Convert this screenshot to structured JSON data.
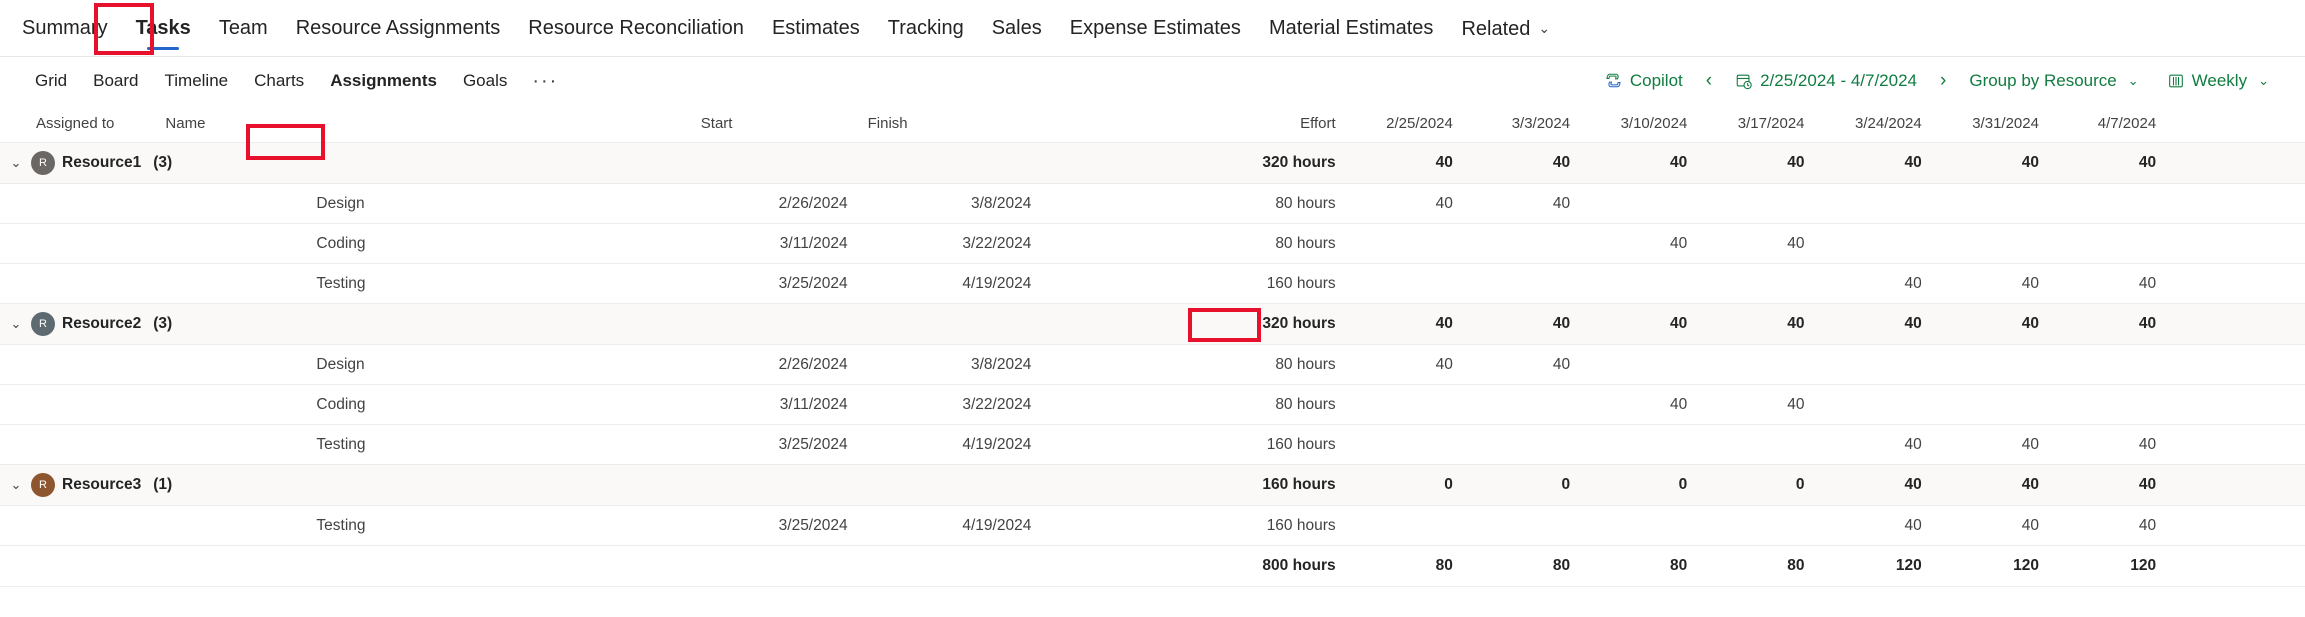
{
  "topnav": {
    "items": [
      {
        "label": "Summary",
        "active": false,
        "caret": false
      },
      {
        "label": "Tasks",
        "active": true,
        "caret": false
      },
      {
        "label": "Team",
        "active": false,
        "caret": false
      },
      {
        "label": "Resource Assignments",
        "active": false,
        "caret": false
      },
      {
        "label": "Resource Reconciliation",
        "active": false,
        "caret": false
      },
      {
        "label": "Estimates",
        "active": false,
        "caret": false
      },
      {
        "label": "Tracking",
        "active": false,
        "caret": false
      },
      {
        "label": "Sales",
        "active": false,
        "caret": false
      },
      {
        "label": "Expense Estimates",
        "active": false,
        "caret": false
      },
      {
        "label": "Material Estimates",
        "active": false,
        "caret": false
      },
      {
        "label": "Related",
        "active": false,
        "caret": true
      }
    ],
    "caret_glyph": "⌄"
  },
  "subnav": {
    "items": [
      {
        "label": "Grid",
        "active": false
      },
      {
        "label": "Board",
        "active": false
      },
      {
        "label": "Timeline",
        "active": false
      },
      {
        "label": "Charts",
        "active": false
      },
      {
        "label": "Assignments",
        "active": true
      },
      {
        "label": "Goals",
        "active": false
      }
    ],
    "overflow_label": "···"
  },
  "toolbar": {
    "copilot_label": "Copilot",
    "prev_glyph": "‹",
    "next_glyph": "›",
    "date_range": "2/25/2024 - 4/7/2024",
    "group_by_label": "Group by Resource",
    "scale_label": "Weekly",
    "caret_glyph": "⌄",
    "accent_color": "#107c41"
  },
  "grid": {
    "columns": {
      "assigned_to": "Assigned to",
      "name": "Name",
      "start": "Start",
      "finish": "Finish",
      "effort": "Effort"
    },
    "week_columns": [
      "2/25/2024",
      "3/3/2024",
      "3/10/2024",
      "3/17/2024",
      "3/24/2024",
      "3/31/2024",
      "4/7/2024"
    ],
    "groups": [
      {
        "name": "Resource1",
        "count": "(3)",
        "avatar_letter": "R",
        "avatar_color": "#6b6764",
        "effort": "320 hours",
        "weeks": [
          "40",
          "40",
          "40",
          "40",
          "40",
          "40",
          "40"
        ],
        "tasks": [
          {
            "name": "Design",
            "start": "2/26/2024",
            "finish": "3/8/2024",
            "effort": "80 hours",
            "weeks": [
              "40",
              "40",
              "",
              "",
              "",
              "",
              ""
            ]
          },
          {
            "name": "Coding",
            "start": "3/11/2024",
            "finish": "3/22/2024",
            "effort": "80 hours",
            "weeks": [
              "",
              "",
              "40",
              "40",
              "",
              "",
              ""
            ]
          },
          {
            "name": "Testing",
            "start": "3/25/2024",
            "finish": "4/19/2024",
            "effort": "160 hours",
            "weeks": [
              "",
              "",
              "",
              "",
              "40",
              "40",
              "40"
            ]
          }
        ]
      },
      {
        "name": "Resource2",
        "count": "(3)",
        "avatar_letter": "R",
        "avatar_color": "#5d6b70",
        "effort": "320 hours",
        "weeks": [
          "40",
          "40",
          "40",
          "40",
          "40",
          "40",
          "40"
        ],
        "tasks": [
          {
            "name": "Design",
            "start": "2/26/2024",
            "finish": "3/8/2024",
            "effort": "80 hours",
            "weeks": [
              "40",
              "40",
              "",
              "",
              "",
              "",
              ""
            ]
          },
          {
            "name": "Coding",
            "start": "3/11/2024",
            "finish": "3/22/2024",
            "effort": "80 hours",
            "weeks": [
              "",
              "",
              "40",
              "40",
              "",
              "",
              ""
            ]
          },
          {
            "name": "Testing",
            "start": "3/25/2024",
            "finish": "4/19/2024",
            "effort": "160 hours",
            "weeks": [
              "",
              "",
              "",
              "",
              "40",
              "40",
              "40"
            ]
          }
        ]
      },
      {
        "name": "Resource3",
        "count": "(1)",
        "avatar_letter": "R",
        "avatar_color": "#8e562e",
        "effort": "160 hours",
        "weeks": [
          "0",
          "0",
          "0",
          "0",
          "40",
          "40",
          "40"
        ],
        "tasks": [
          {
            "name": "Testing",
            "start": "3/25/2024",
            "finish": "4/19/2024",
            "effort": "160 hours",
            "weeks": [
              "",
              "",
              "",
              "",
              "40",
              "40",
              "40"
            ]
          }
        ]
      }
    ],
    "total": {
      "effort": "800 hours",
      "weeks": [
        "80",
        "80",
        "80",
        "80",
        "120",
        "120",
        "120"
      ]
    }
  },
  "annotations": {
    "highlight_color": "#e8112d",
    "boxes": [
      "tasks-tab",
      "assignments-subtab",
      "design-week-3-3-cell"
    ]
  }
}
